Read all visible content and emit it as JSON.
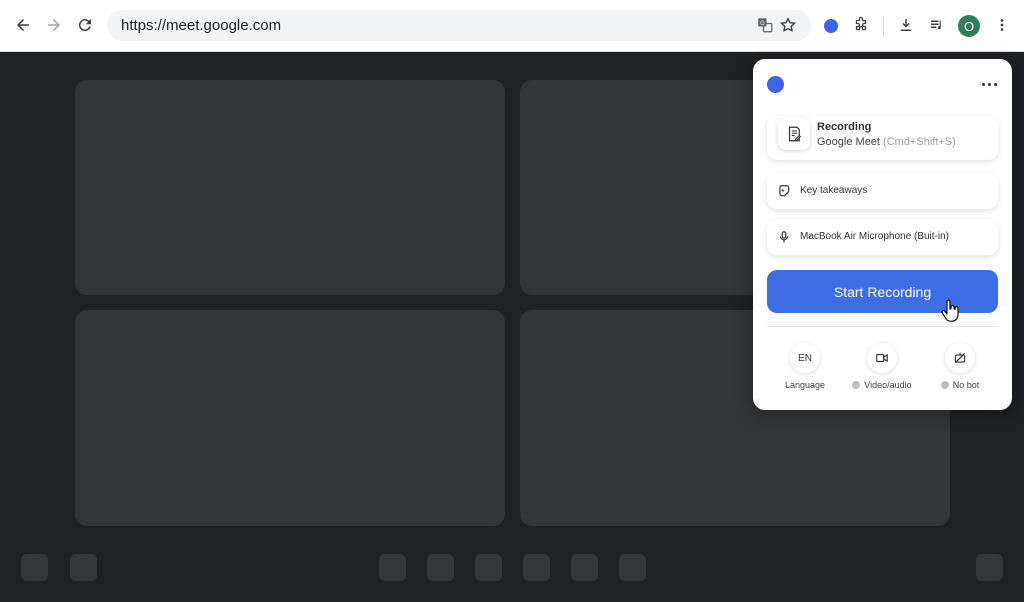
{
  "browser": {
    "url": "https://meet.google.com",
    "profile_initial": "O",
    "icons": [
      "back-icon",
      "forward-icon",
      "reload-icon",
      "translate-icon",
      "star-icon",
      "extension-dot-icon",
      "puzzle-icon",
      "download-icon",
      "media-queue-icon",
      "kebab-menu-icon"
    ]
  },
  "popup": {
    "recording_card": {
      "title": "Recording",
      "app_name": "Google Meet",
      "shortcut": "(Cmd+Shift+S)"
    },
    "key_takeaways_label": "Key takeaways",
    "microphone_label": "MacBook Air Microphone (Buit-in)",
    "start_button_label": "Start Recording",
    "options": {
      "language_code": "EN",
      "language_label": "Language",
      "video_label": "Video/audio",
      "nobot_label": "No bot"
    }
  },
  "colors": {
    "accent": "#3e6de6",
    "meet_background": "#202124",
    "tile": "#343538"
  }
}
